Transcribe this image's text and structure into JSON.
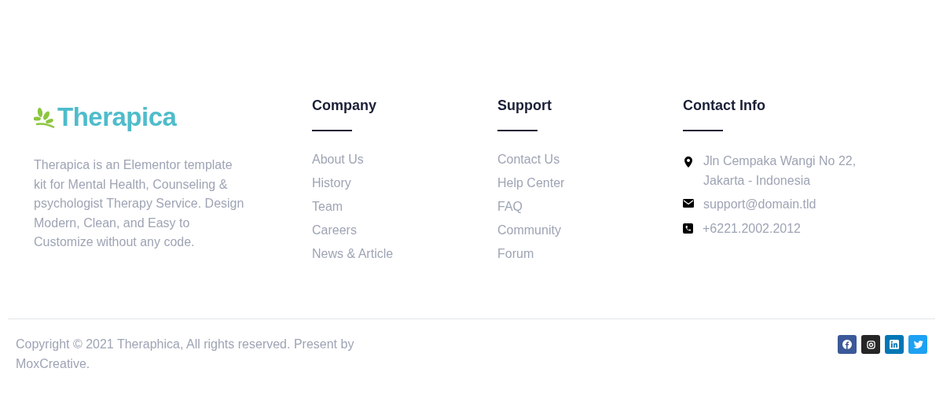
{
  "brand": {
    "name": "Therapica",
    "description": "Therapica is an Elementor template kit for Mental Health, Counseling & psychologist Therapy Service. Design Modern, Clean, and Easy to Customize without any code."
  },
  "link_columns": [
    {
      "title": "Company",
      "links": [
        "About Us",
        "History",
        "Team",
        "Careers",
        "News & Article"
      ]
    },
    {
      "title": "Support",
      "links": [
        "Contact Us",
        "Help Center",
        "FAQ",
        "Community",
        "Forum"
      ]
    }
  ],
  "contact": {
    "title": "Contact Info",
    "items": [
      {
        "kind": "address",
        "text": "Jln Cempaka Wangi No 22, Jakarta - Indonesia"
      },
      {
        "kind": "email",
        "text": "support@domain.tld"
      },
      {
        "kind": "phone",
        "text": "+6221.2002.2012"
      }
    ]
  },
  "copyright": "Copyright © 2021 Theraphica, All rights reserved. Present by MoxCreative.",
  "social": [
    {
      "kind": "facebook",
      "color": "#3b5998"
    },
    {
      "kind": "instagram",
      "color": "#262626"
    },
    {
      "kind": "linkedin",
      "color": "#0077b5"
    },
    {
      "kind": "twitter",
      "color": "#1da1f2"
    }
  ]
}
